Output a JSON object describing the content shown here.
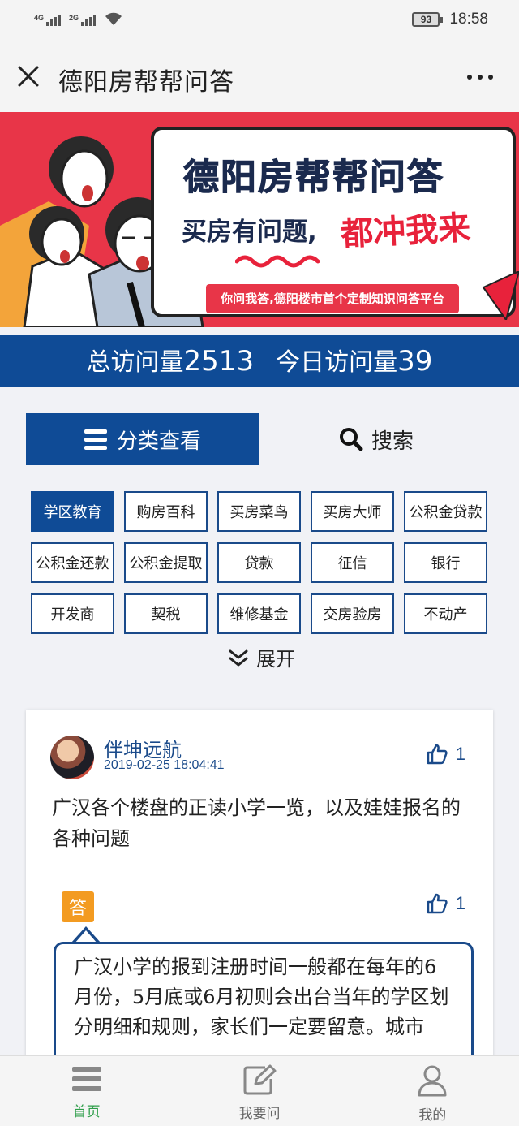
{
  "status_bar": {
    "signal1": "4G",
    "signal2": "2G",
    "battery": "93",
    "time": "18:58"
  },
  "titlebar": {
    "title": "德阳房帮帮问答"
  },
  "banner": {
    "title": "德阳房帮帮问答",
    "subtitle": "买房有问题,",
    "slogan": "都冲我来",
    "tagline": "你问我答,德阳楼市首个定制知识问答平台"
  },
  "stats": {
    "total_label": "总访问量",
    "total_value": "2513",
    "today_label": "今日访问量",
    "today_value": "39"
  },
  "tabs": {
    "category": "分类查看",
    "search": "搜索"
  },
  "categories": [
    "学区教育",
    "购房百科",
    "买房菜鸟",
    "买房大师",
    "公积金贷款",
    "公积金还款",
    "公积金提取",
    "贷款",
    "征信",
    "银行",
    "开发商",
    "契税",
    "维修基金",
    "交房验房",
    "不动产"
  ],
  "expand_label": "展开",
  "post": {
    "username": "伴坤远航",
    "time": "2019-02-25 18:04:41",
    "likes": "1",
    "question": "广汉各个楼盘的正读小学一览，以及娃娃报名的各种问题",
    "answer_badge": "答",
    "answer_likes": "1",
    "answer": "广汉小学的报到注册时间一般都在每年的6月份，5月底或6月初则会出台当年的学区划分明细和规则，家长们一定要留意。城市"
  },
  "bottom_nav": [
    {
      "label": "首页",
      "icon": "home-menu-icon"
    },
    {
      "label": "我要问",
      "icon": "edit-icon"
    },
    {
      "label": "我的",
      "icon": "user-icon"
    }
  ],
  "colors": {
    "primary": "#0f4b96",
    "banner_red": "#e83548",
    "answer_orange": "#f39b21",
    "active_nav": "#2e9e4a"
  }
}
